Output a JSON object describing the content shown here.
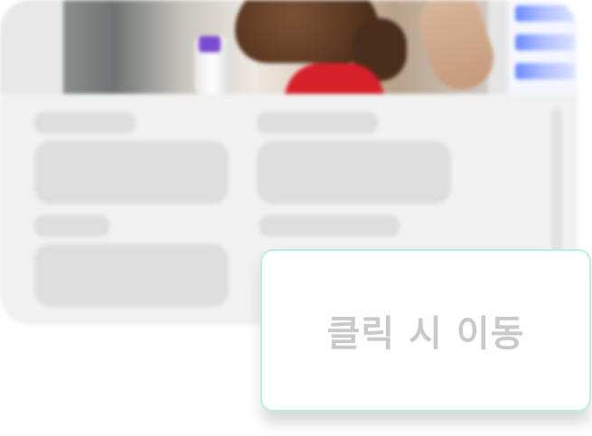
{
  "cta": {
    "label": "클릭 시 이동"
  },
  "theme": {
    "background": "#ffffff",
    "panel": "#f1f1f1",
    "skeleton": "#dedede",
    "cta_border": "#b9f1dd",
    "cta_text": "#c9c9c9",
    "accent_blue": "#4a70ff",
    "accent_red": "#d6202a"
  },
  "icons": {
    "placeholder": "skeleton-blocks"
  }
}
